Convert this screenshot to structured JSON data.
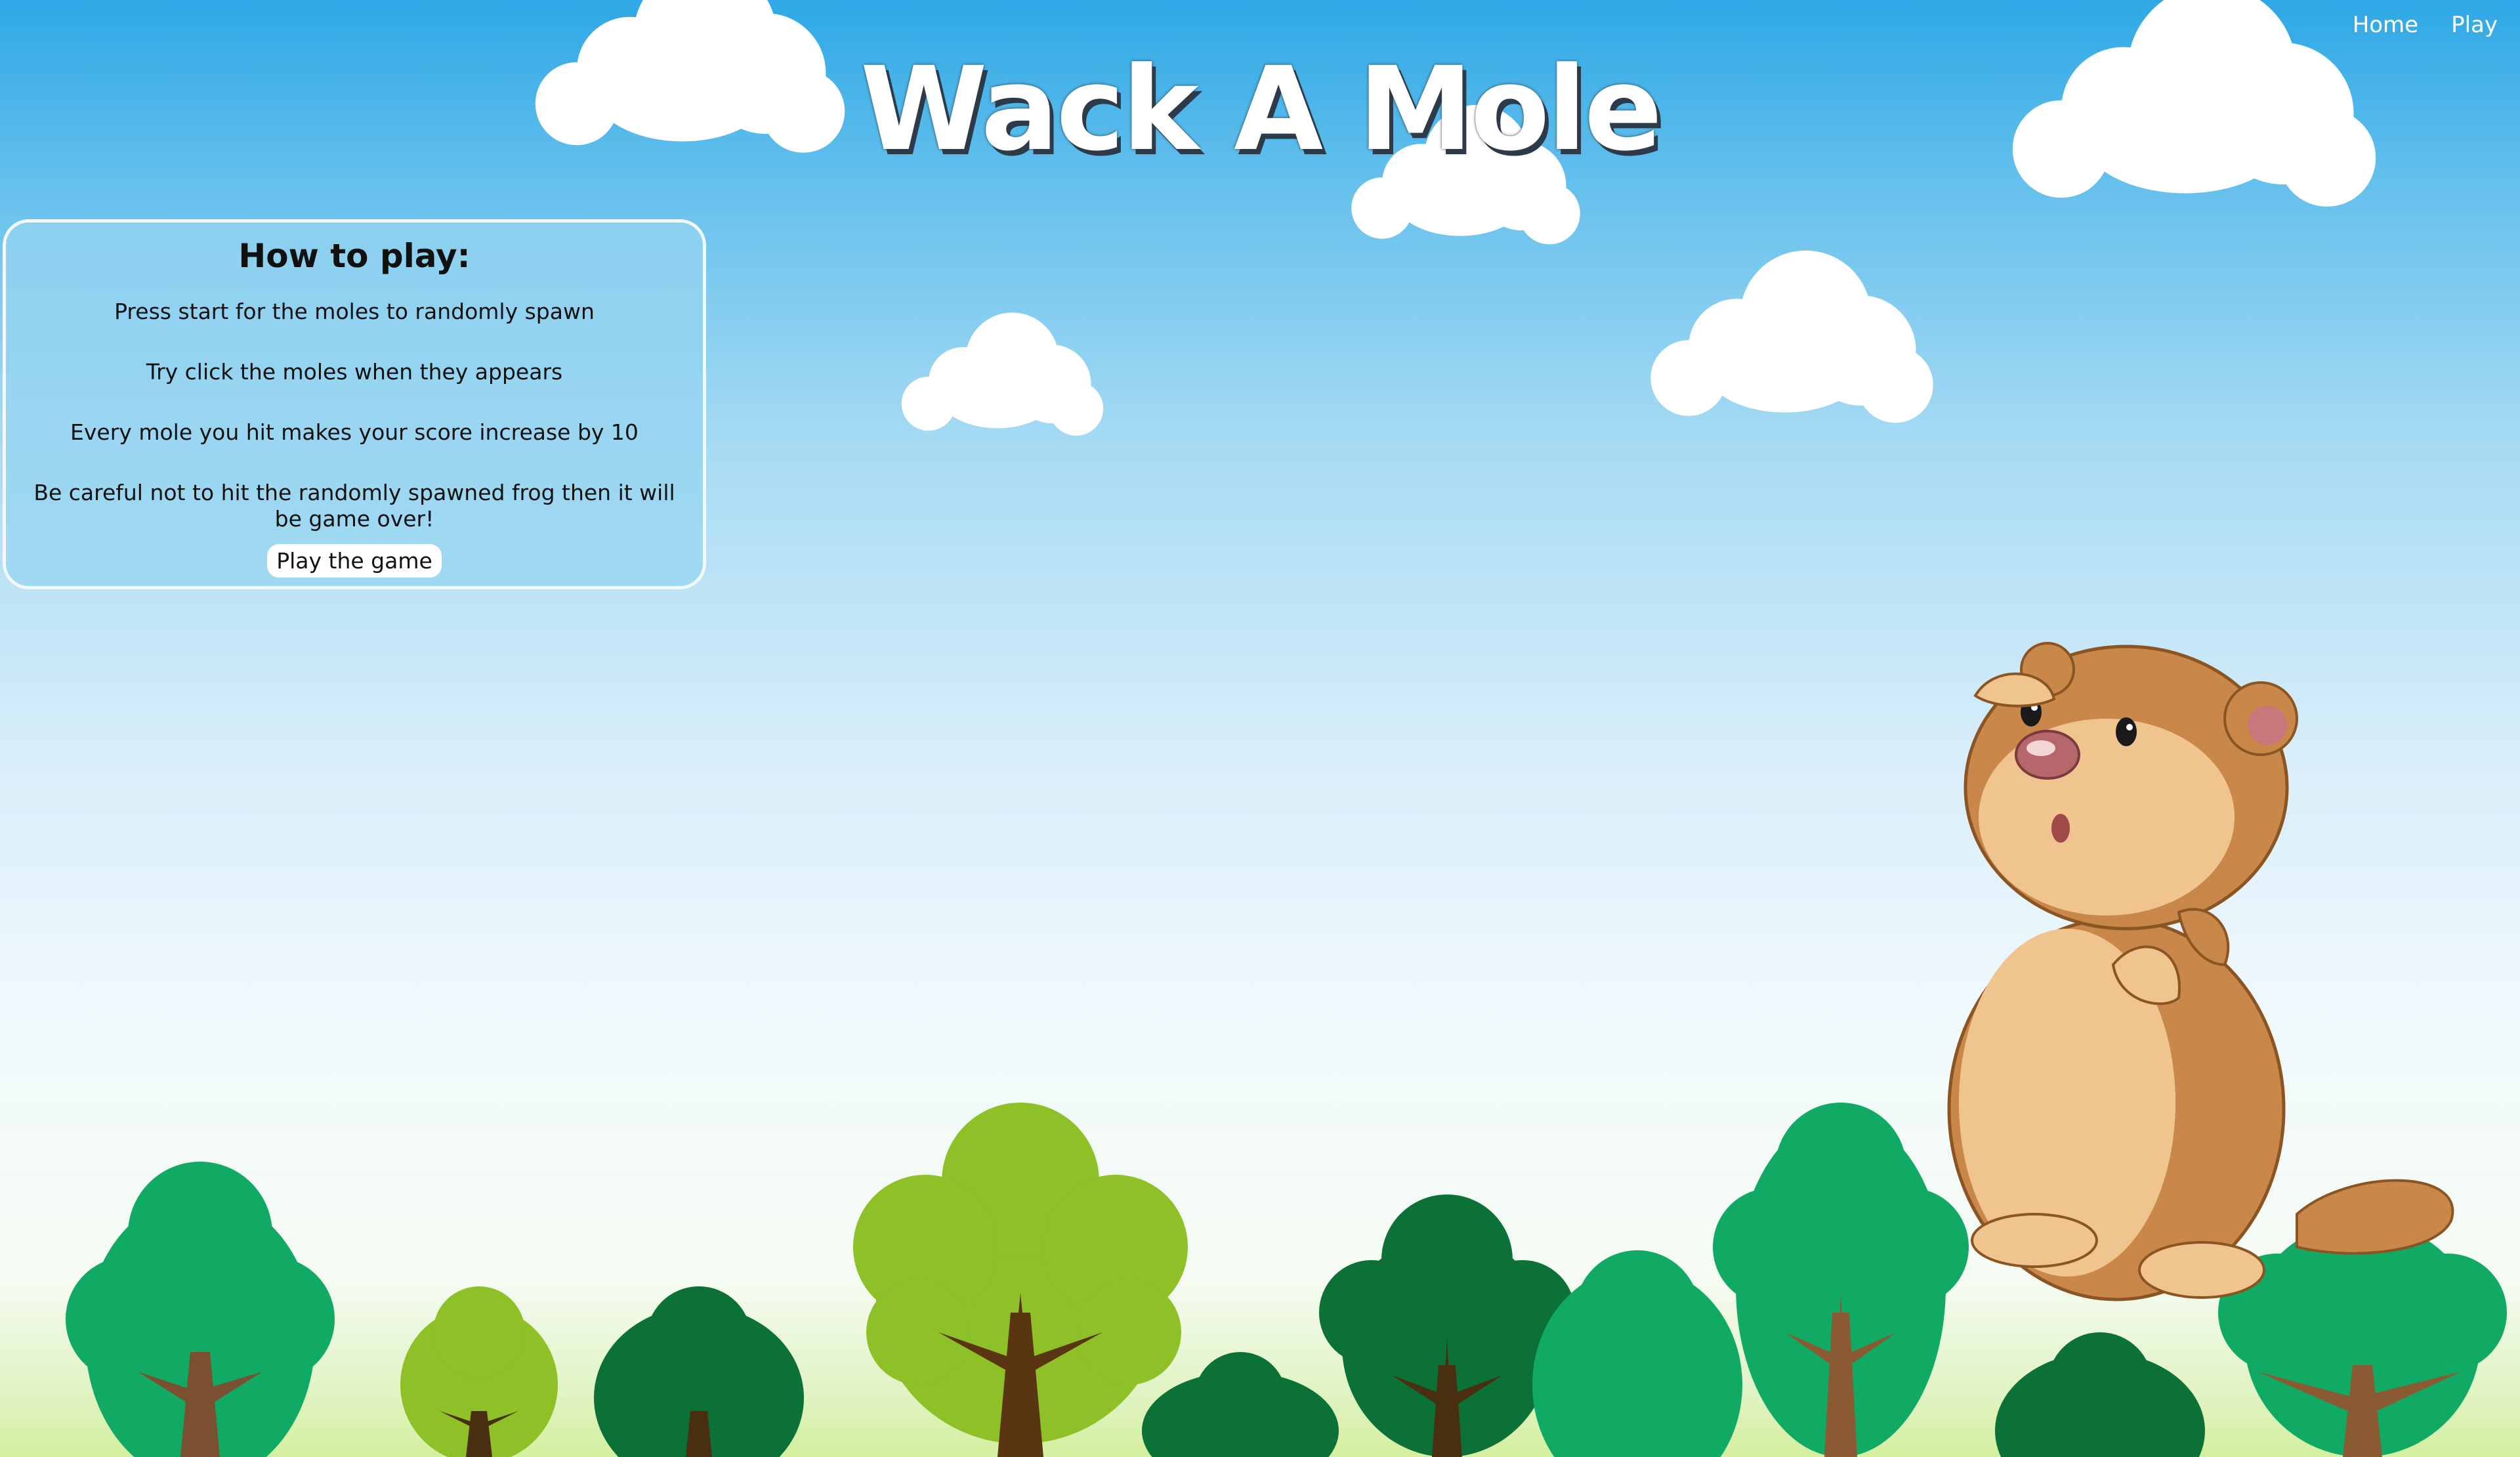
{
  "app": {
    "title": "Wack A Mole"
  },
  "nav": {
    "items": [
      {
        "label": "Home"
      },
      {
        "label": "Play"
      }
    ]
  },
  "instructions": {
    "heading": "How to play:",
    "lines": [
      "Press start for the moles to randomly spawn",
      "Try click the moles when they appears",
      "Every mole you hit makes your score increase by 10",
      "Be careful not to hit the randomly spawned frog then it will be game over!"
    ],
    "button_label": "Play the game"
  },
  "decor": {
    "character": "mole-mascot",
    "tree_icons": [
      "tree-icon"
    ],
    "cloud_icons": [
      "cloud-icon"
    ],
    "colors": {
      "sky_top": "#2ea8e6",
      "grass": "#d4ef9e",
      "tree_light": "#8dc127",
      "tree_mid": "#10aa64",
      "tree_dark": "#0b7137",
      "trunk": "#6b4a2a",
      "mole_fur": "#c9884a",
      "mole_belly": "#f0c48e"
    }
  }
}
